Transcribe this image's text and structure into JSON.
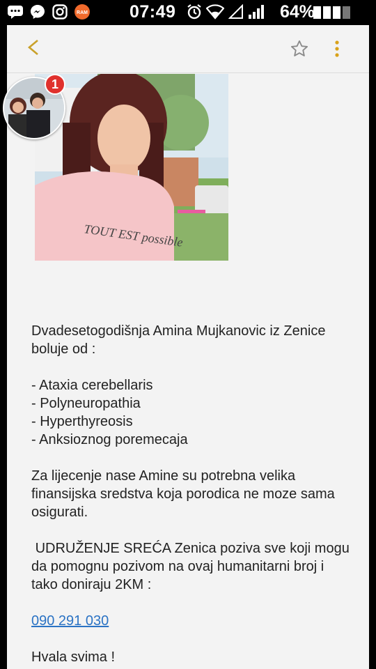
{
  "statusbar": {
    "time": "07:49",
    "battery_percent": "64%",
    "battery_level": 0.64,
    "left_icons": [
      "chat-icon",
      "messenger-icon",
      "instagram-icon",
      "ram-app-icon"
    ],
    "ram_label": "RAM"
  },
  "toolbar": {
    "icons": [
      "back-arrow-icon",
      "star-icon",
      "more-vert-icon"
    ]
  },
  "chathead": {
    "badge_count": "1"
  },
  "post": {
    "intro": "Dvadesetogodišnja Amina Mujkanovic iz Zenice boluje od :",
    "conditions": [
      "- Ataxia cerebellaris",
      "- Polyneuropathia",
      "- Hyperthyreosis",
      "- Anksioznog poremecaja"
    ],
    "para2": "Za lijecenje nase Amine su potrebna velika finansijska sredstva koja porodica ne moze sama osigurati.",
    "para3": " UDRUŽENJE SREĆA Zenica poziva sve koji mogu da pomognu pozivom na ovaj humanitarni broj i tako doniraju 2KM :",
    "phone": "090 291 030",
    "closing": "Hvala svima !",
    "photo_shirt_text": "TOUT EST possible"
  },
  "colors": {
    "accent_link": "#2b73c4",
    "more_dots": "#d9a21a",
    "badge": "#e0312d"
  }
}
